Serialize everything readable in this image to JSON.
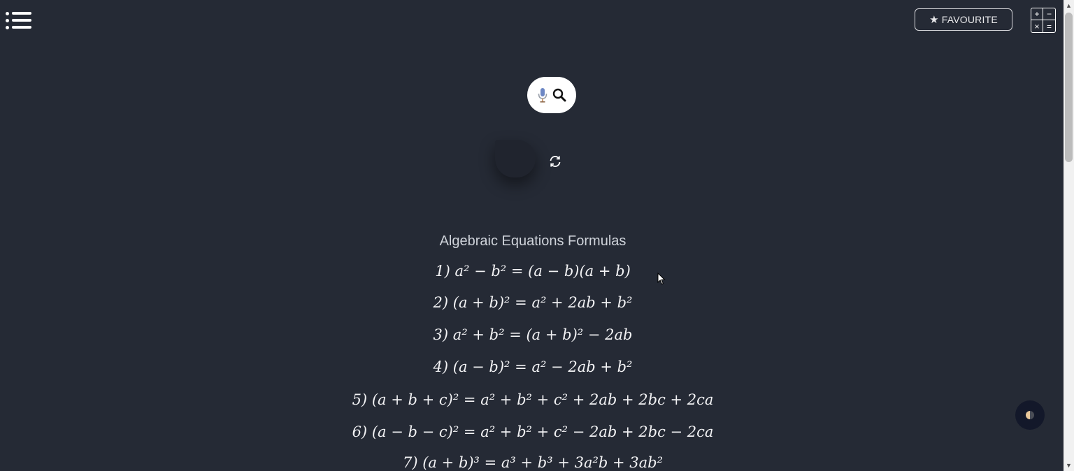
{
  "header": {
    "menu_icon": "hamburger-menu-icon",
    "favourite_label": "FAVOURITE",
    "favourite_icon": "★",
    "calculator_symbols": [
      "+",
      "−",
      "×",
      "="
    ]
  },
  "search": {
    "mic_icon": "microphone-icon",
    "search_icon": "magnifier-icon"
  },
  "content": {
    "title": "Algebraic Equations Formulas",
    "formulas": [
      {
        "num": "1)",
        "lhs": "a² − b²",
        "rhs": "= (a − b)(a + b)"
      },
      {
        "num": "2)",
        "lhs": "(a + b)²",
        "rhs": "= a² + 2ab + b²"
      },
      {
        "num": "3)",
        "lhs": "a² + b²",
        "rhs": "= (a + b)² − 2ab"
      },
      {
        "num": "4)",
        "lhs": "(a − b)²",
        "rhs": "= a² − 2ab + b²"
      },
      {
        "num": "5)",
        "lhs": "(a + b + c)²",
        "rhs": "= a² + b² + c² + 2ab + 2bc + 2ca"
      },
      {
        "num": "6)",
        "lhs": "(a − b − c)²",
        "rhs": "= a² + b² + c² − 2ab + 2bc − 2ca"
      },
      {
        "num": "7)",
        "lhs": "(a + b)³",
        "rhs": "= a³ + b³ + 3a²b + 3ab²"
      }
    ]
  },
  "colors": {
    "background": "#252a35",
    "text": "#e8e8ea",
    "search_bg": "#ffffff"
  }
}
